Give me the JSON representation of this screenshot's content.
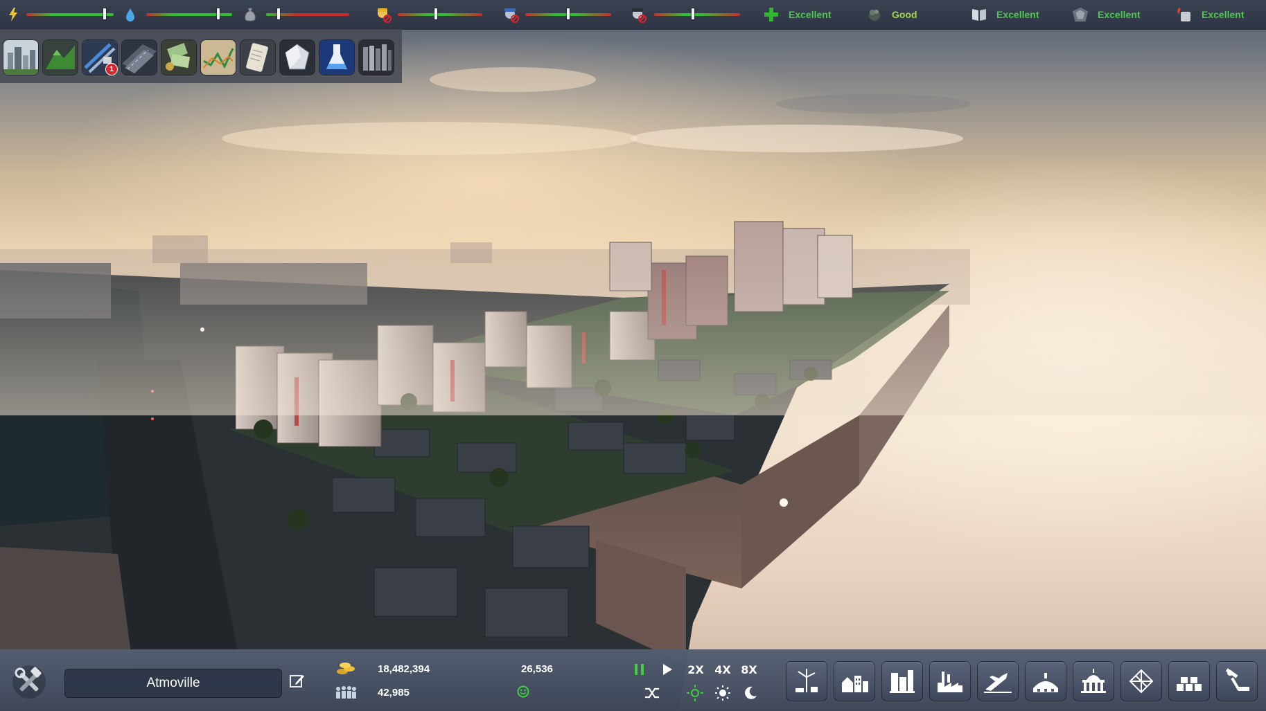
{
  "top_bar": {
    "meters": [
      {
        "icon": "power-icon",
        "level": 0.9
      },
      {
        "icon": "water-drop-icon",
        "level": 0.84
      },
      {
        "icon": "garbage-bag-icon",
        "level": 0.15
      },
      {
        "icon": "health-worker-icon",
        "level": 0.45
      },
      {
        "icon": "police-officer-icon",
        "level": 0.5
      },
      {
        "icon": "firefighter-icon",
        "level": 0.45
      }
    ],
    "ratings": [
      {
        "icon": "health-cross-icon",
        "label": "Excellent"
      },
      {
        "icon": "pollution-icon",
        "label": "Good"
      },
      {
        "icon": "education-book-icon",
        "label": "Excellent"
      },
      {
        "icon": "police-badge-icon",
        "label": "Excellent"
      },
      {
        "icon": "fire-safety-icon",
        "label": "Excellent"
      }
    ],
    "colors": {
      "rating_text": "#4dc94d",
      "good_text": "#a7d84a",
      "meter_green": "#2fc02f",
      "meter_red": "#c92a2a"
    }
  },
  "category_bar": {
    "items": [
      {
        "icon": "city-overview-icon"
      },
      {
        "icon": "terrain-icon"
      },
      {
        "icon": "infrastructure-icon",
        "badge": "1"
      },
      {
        "icon": "roads-icon"
      },
      {
        "icon": "budget-money-icon"
      },
      {
        "icon": "economy-graph-icon"
      },
      {
        "icon": "policies-scroll-icon"
      },
      {
        "icon": "resources-crystal-icon"
      },
      {
        "icon": "research-flask-icon"
      },
      {
        "icon": "library-books-icon"
      }
    ]
  },
  "bottom_bar": {
    "city_name": "Atmoville",
    "money": "18,482,394",
    "population": "42,985",
    "income": "26,536",
    "happiness_icon": "smiley-icon",
    "speed": {
      "pause_icon": "pause-icon",
      "play_icon": "play-icon",
      "x2": "2X",
      "x4": "4X",
      "x8": "8X"
    },
    "time_controls": [
      "shuffle-icon",
      "sun-cycle-icon",
      "day-sun-icon",
      "night-moon-icon"
    ],
    "build_categories": [
      {
        "icon": "energy-build-icon"
      },
      {
        "icon": "residential-build-icon"
      },
      {
        "icon": "commercial-build-icon"
      },
      {
        "icon": "industrial-build-icon"
      },
      {
        "icon": "transport-build-icon"
      },
      {
        "icon": "services-build-icon"
      },
      {
        "icon": "government-build-icon"
      },
      {
        "icon": "special-build-icon"
      },
      {
        "icon": "foundation-build-icon"
      },
      {
        "icon": "bulldoze-tools-icon"
      }
    ]
  }
}
